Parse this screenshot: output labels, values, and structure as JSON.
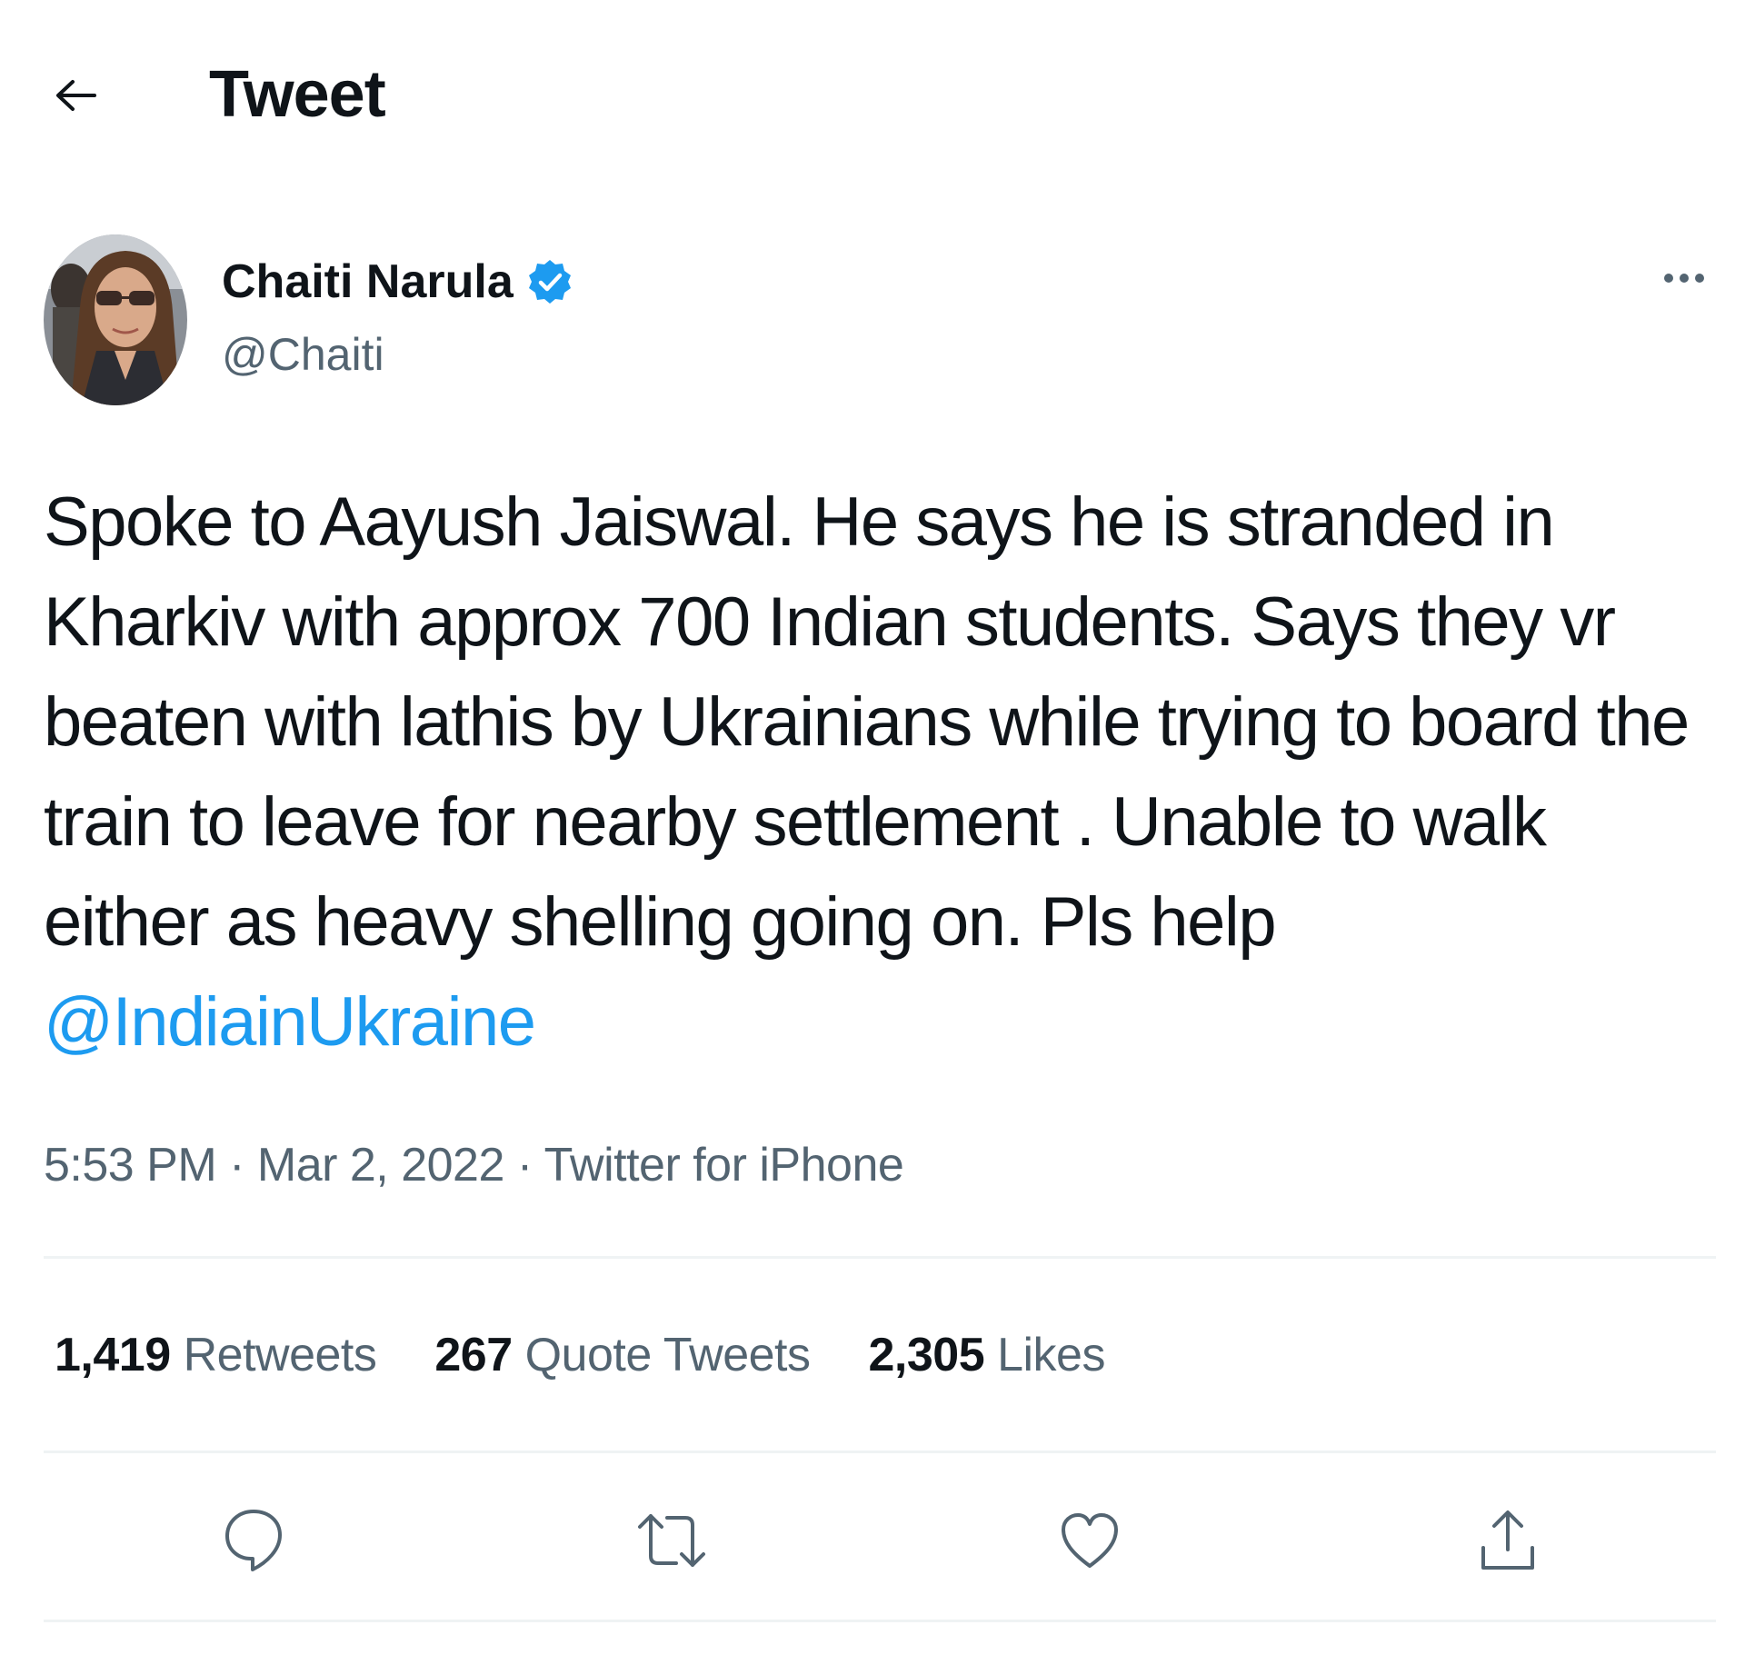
{
  "header": {
    "title": "Tweet",
    "back_icon": "arrow-left-icon"
  },
  "author": {
    "display_name": "Chaiti Narula",
    "handle": "@Chaiti",
    "verified": true,
    "verified_color": "#1d9bf0"
  },
  "tweet": {
    "text": "Spoke to Aayush Jaiswal. He says he is stranded in Kharkiv with approx 700 Indian students. Says they vr beaten with lathis by Ukrainians while trying to board the train to leave for nearby settlement . Unable to walk either as heavy shelling going on. Pls help ",
    "mention": "@IndiainUkraine",
    "mention_color": "#1d9bf0"
  },
  "meta": {
    "time": "5:53 PM",
    "separator": " · ",
    "date": "Mar 2, 2022",
    "source": "Twitter for iPhone"
  },
  "stats": {
    "retweets_count": "1,419",
    "retweets_label": "Retweets",
    "quotes_count": "267",
    "quotes_label": "Quote Tweets",
    "likes_count": "2,305",
    "likes_label": "Likes"
  },
  "actions": [
    "reply-icon",
    "retweet-icon",
    "like-icon",
    "share-icon"
  ]
}
